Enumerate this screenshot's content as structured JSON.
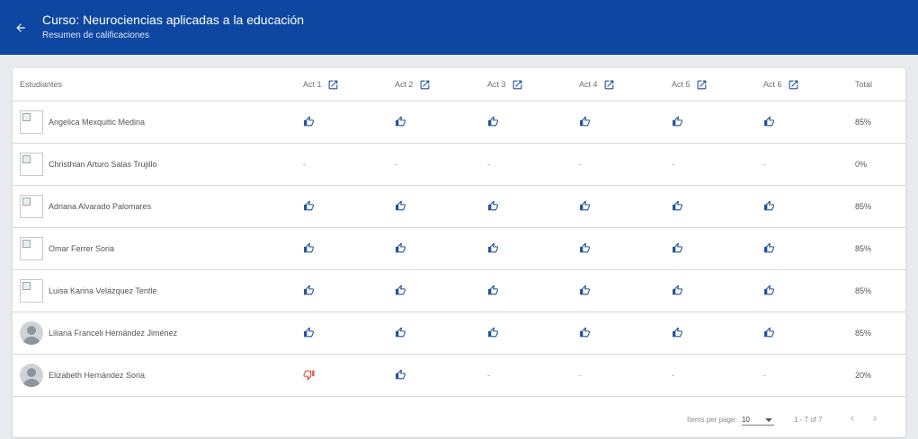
{
  "header": {
    "title": "Curso: Neurociencias aplicadas a la educación",
    "subtitle": "Resumen de calificaciones",
    "back_icon": "arrow-left-icon"
  },
  "table": {
    "columns": {
      "student": "Estudiantes",
      "acts": [
        "Act 1",
        "Act 2",
        "Act 3",
        "Act 4",
        "Act 5",
        "Act 6"
      ],
      "total": "Total"
    },
    "rows": [
      {
        "name": "Angelica Mexquitic Medina",
        "avatar": "broken-image",
        "grades": [
          "up",
          "up",
          "up",
          "up",
          "up",
          "up"
        ],
        "total": "85%"
      },
      {
        "name": "Christhian Arturo Salas Trujillo",
        "avatar": "broken-image",
        "grades": [
          "-",
          "-",
          "-",
          "-",
          "-",
          "-"
        ],
        "total": "0%"
      },
      {
        "name": "Adriana Alvarado Palomares",
        "avatar": "broken-image",
        "grades": [
          "up",
          "up",
          "up",
          "up",
          "up",
          "up"
        ],
        "total": "85%"
      },
      {
        "name": "Omar Ferrer Soria",
        "avatar": "broken-image",
        "grades": [
          "up",
          "up",
          "up",
          "up",
          "up",
          "up"
        ],
        "total": "85%"
      },
      {
        "name": "Luisa Karina Velázquez Tentle",
        "avatar": "broken-image",
        "grades": [
          "up",
          "up",
          "up",
          "up",
          "up",
          "up"
        ],
        "total": "85%"
      },
      {
        "name": "Liliana Franceli Hernández Jiménez",
        "avatar": "person",
        "grades": [
          "up",
          "up",
          "up",
          "up",
          "up",
          "up"
        ],
        "total": "85%"
      },
      {
        "name": "Elizabeth Hernández Soria",
        "avatar": "person",
        "grades": [
          "down",
          "up",
          "-",
          "-",
          "-",
          "-"
        ],
        "total": "20%"
      }
    ]
  },
  "paginator": {
    "items_per_page_label": "Items per page:",
    "items_per_page_value": "10",
    "range_label": "1 - 7 of 7"
  },
  "colors": {
    "header_bg": "#0e47a1",
    "thumb_up": "#1f4f9c",
    "thumb_down": "#e0433b"
  }
}
